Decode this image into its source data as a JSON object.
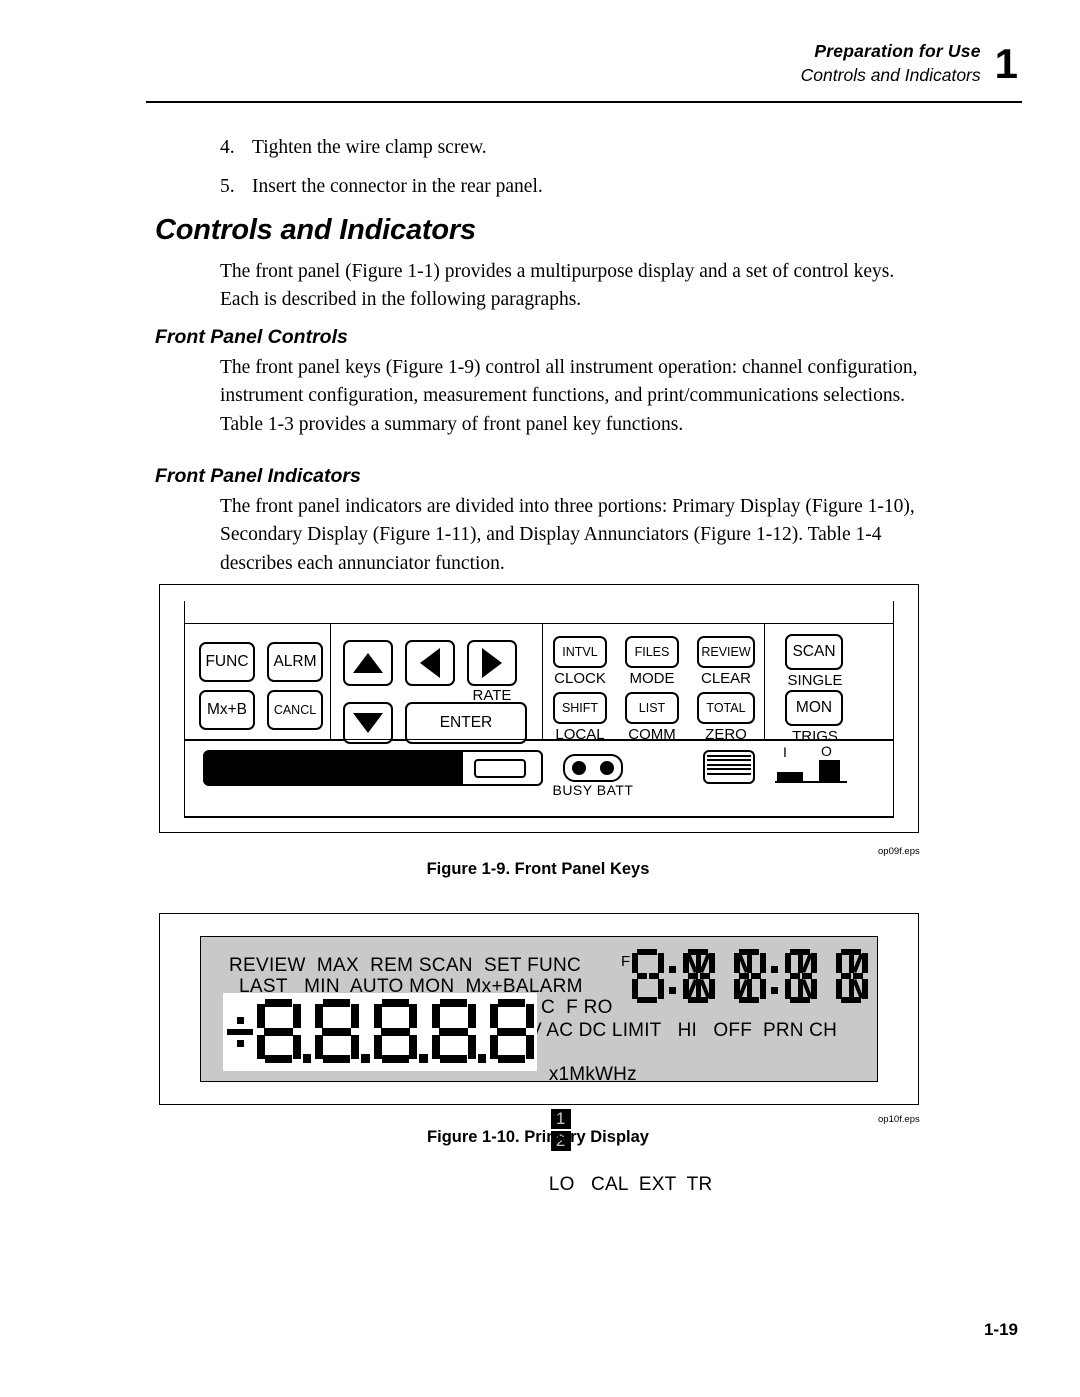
{
  "header": {
    "title": "Preparation for Use",
    "subtitle": "Controls and Indicators",
    "chapter_number": "1"
  },
  "steps": [
    {
      "number": "4.",
      "text": "Tighten the wire clamp screw."
    },
    {
      "number": "5.",
      "text": "Insert the connector in the rear panel."
    }
  ],
  "section": {
    "heading": "Controls and Indicators",
    "intro": "The front panel (Figure 1-1) provides a multipurpose display and a set of control keys. Each is described in the following paragraphs."
  },
  "subsections": [
    {
      "heading": "Front Panel Controls",
      "text": "The front panel keys (Figure 1-9) control all instrument operation: channel configuration, instrument configuration, measurement functions, and print/communications selections. Table 1-3 provides a summary of front panel key functions."
    },
    {
      "heading": "Front Panel Indicators",
      "text": "The front panel indicators are divided into three portions: Primary Display (Figure 1-10), Secondary Display (Figure 1-11), and Display Annunciators (Figure 1-12). Table 1-4 describes each annunciator function."
    }
  ],
  "figure_keys": {
    "caption": "Figure 1-9. Front Panel Keys",
    "eps_tag": "op09f.eps",
    "group1": [
      {
        "key": "FUNC"
      },
      {
        "key": "ALRM"
      },
      {
        "key": "Mx+B"
      },
      {
        "key": "CANCL"
      }
    ],
    "group2": {
      "up": "up-arrow",
      "down": "down-arrow",
      "left": "left-arrow",
      "right": "right-arrow",
      "rate_label": "RATE",
      "enter": "ENTER"
    },
    "group3": [
      {
        "key": "INTVL",
        "shifted": "CLOCK"
      },
      {
        "key": "FILES",
        "shifted": "MODE"
      },
      {
        "key": "REVIEW",
        "shifted": "CLEAR"
      },
      {
        "key": "SHIFT",
        "shifted": "LOCAL"
      },
      {
        "key": "LIST",
        "shifted": "COMM"
      },
      {
        "key": "TOTAL",
        "shifted": "ZERO"
      }
    ],
    "group4": [
      {
        "key": "SCAN",
        "shifted": "SINGLE"
      },
      {
        "key": "MON",
        "shifted": "TRIGS"
      }
    ],
    "indicators": {
      "busy": "BUSY",
      "batt": "BATT",
      "led_label": "BUSY BATT"
    },
    "power_switch": {
      "on": "I",
      "off": "O"
    }
  },
  "figure_display": {
    "caption": "Figure 1-10. Primary Display",
    "eps_tag": "op10f.eps",
    "annunciators": {
      "row1": "REVIEW  MAX  REM SCAN  SET FUNC",
      "row2": "LAST   MIN  AUTO MON  Mx+BALARM",
      "row3": "C  F RO",
      "row4": "mV AC DC LIMIT   HI   OFF  PRN CH",
      "row5_prefix": "x1MkWHz",
      "limit1": "1",
      "limit2": "2",
      "row5_suffix": "LO   CAL  EXT  TR"
    },
    "main_digits": {
      "sign": "±",
      "digit_count": 5,
      "pattern": "8.8.8.8.8"
    },
    "secondary": {
      "prefix": "F",
      "pattern": "8:8 8:8 8"
    }
  },
  "page_number": "1-19"
}
